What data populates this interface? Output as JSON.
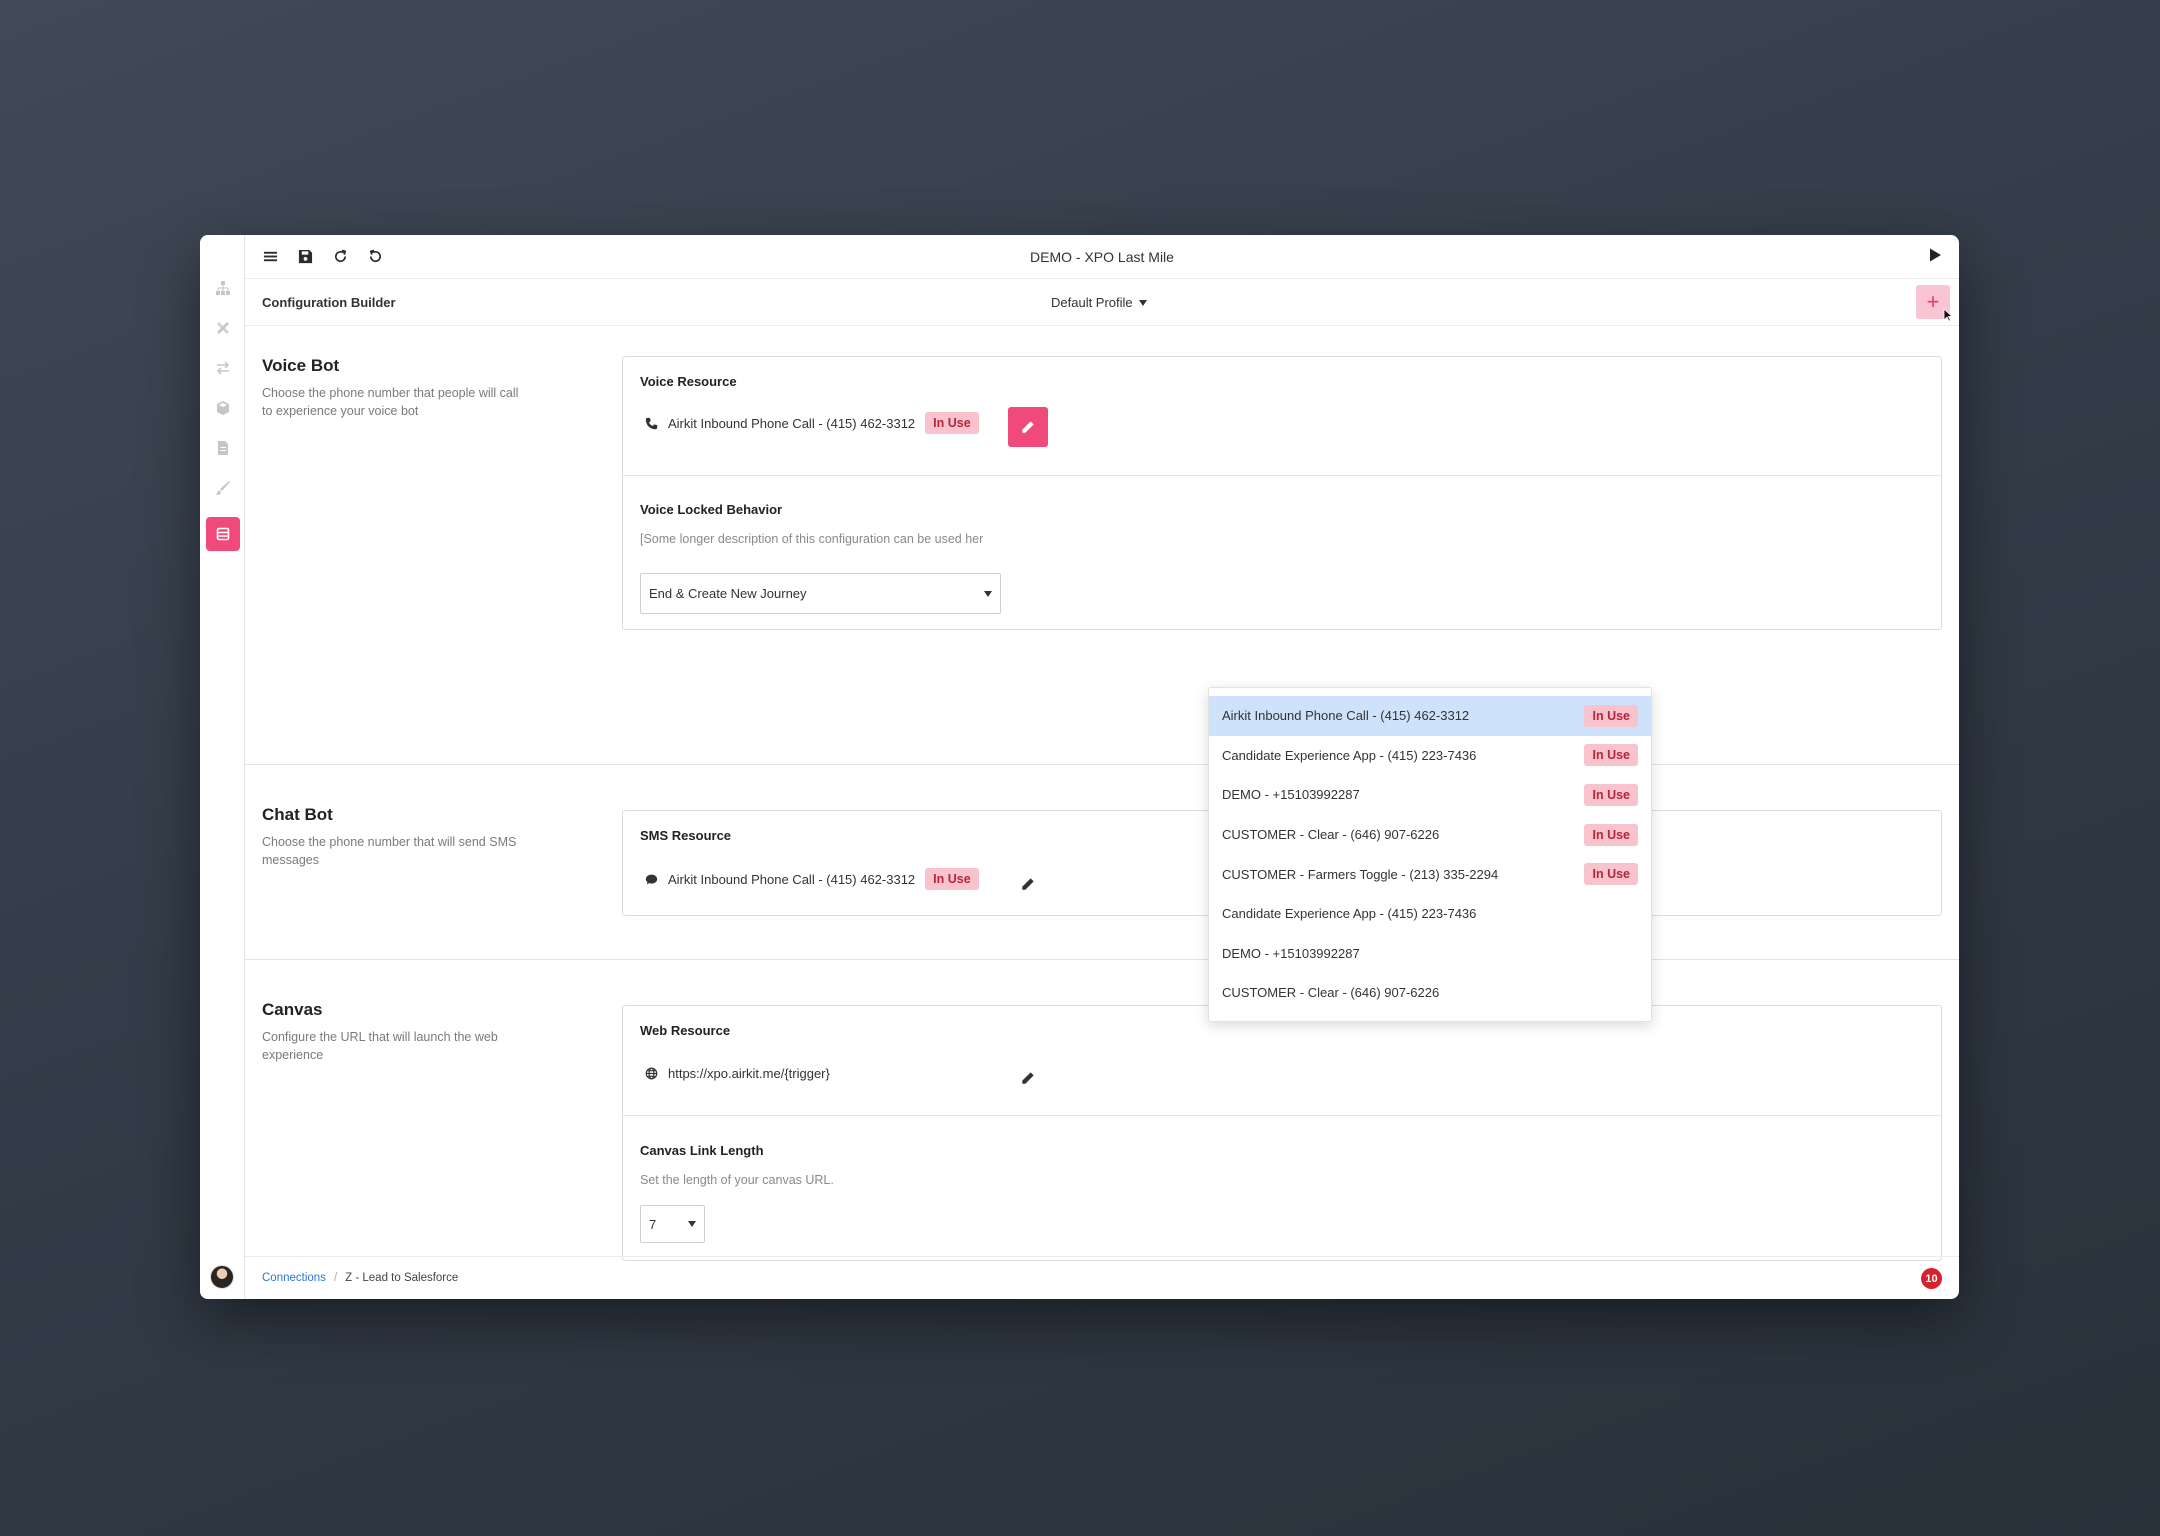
{
  "window": {
    "title": "DEMO - XPO Last Mile"
  },
  "subbar": {
    "title": "Configuration Builder",
    "profile": "Default Profile",
    "add_label": "+"
  },
  "sidebar": {
    "icons": [
      "sitemap-icon",
      "tools-icon",
      "exchange-icon",
      "cube-icon",
      "file-icon",
      "brush-icon",
      "database-icon"
    ],
    "active_icon": "database-icon"
  },
  "voice_bot": {
    "title": "Voice Bot",
    "description": "Choose the phone number that people will call to experience your voice bot",
    "resource_label": "Voice Resource",
    "resource_value": "Airkit Inbound Phone Call - (415) 462-3312",
    "resource_badge": "In Use",
    "locked_label": "Voice Locked Behavior",
    "locked_help": "[Some longer description of this configuration can be used her",
    "locked_value": "End & Create New Journey"
  },
  "chat_bot": {
    "title": "Chat Bot",
    "description": "Choose the phone number that will send SMS messages",
    "resource_label": "SMS Resource",
    "resource_value": "Airkit Inbound Phone Call - (415) 462-3312",
    "resource_badge": "In Use"
  },
  "canvas": {
    "title": "Canvas",
    "description": "Configure the URL that will launch the web experience",
    "resource_label": "Web Resource",
    "resource_value": "https://xpo.airkit.me/{trigger}",
    "link_length_label": "Canvas Link Length",
    "link_length_help": "Set the length of your canvas URL.",
    "link_length_value": "7"
  },
  "dropdown": {
    "items": [
      {
        "label": "Airkit Inbound Phone Call - (415) 462-3312",
        "badge": "In Use",
        "highlighted": true
      },
      {
        "label": "Candidate Experience App - (415) 223-7436",
        "badge": "In Use"
      },
      {
        "label": "DEMO - +15103992287",
        "badge": "In Use"
      },
      {
        "label": "CUSTOMER - Clear - (646) 907-6226",
        "badge": "In Use"
      },
      {
        "label": "CUSTOMER - Farmers Toggle - (213) 335-2294",
        "badge": "In Use"
      },
      {
        "label": "Candidate Experience App - (415) 223-7436",
        "badge": ""
      },
      {
        "label": "DEMO - +15103992287",
        "badge": ""
      },
      {
        "label": "CUSTOMER - Clear - (646) 907-6226",
        "badge": ""
      }
    ]
  },
  "footer": {
    "crumb_link": "Connections",
    "crumb_sep": "/",
    "crumb_current": "Z - Lead to Salesforce",
    "notifications": "10"
  },
  "colors": {
    "accent": "#ef4a7a",
    "badge_bg": "#f8c3cc",
    "badge_text": "#b3263c",
    "highlight": "#cfe2fb",
    "link": "#2f73d8",
    "notif": "#d9202e"
  }
}
